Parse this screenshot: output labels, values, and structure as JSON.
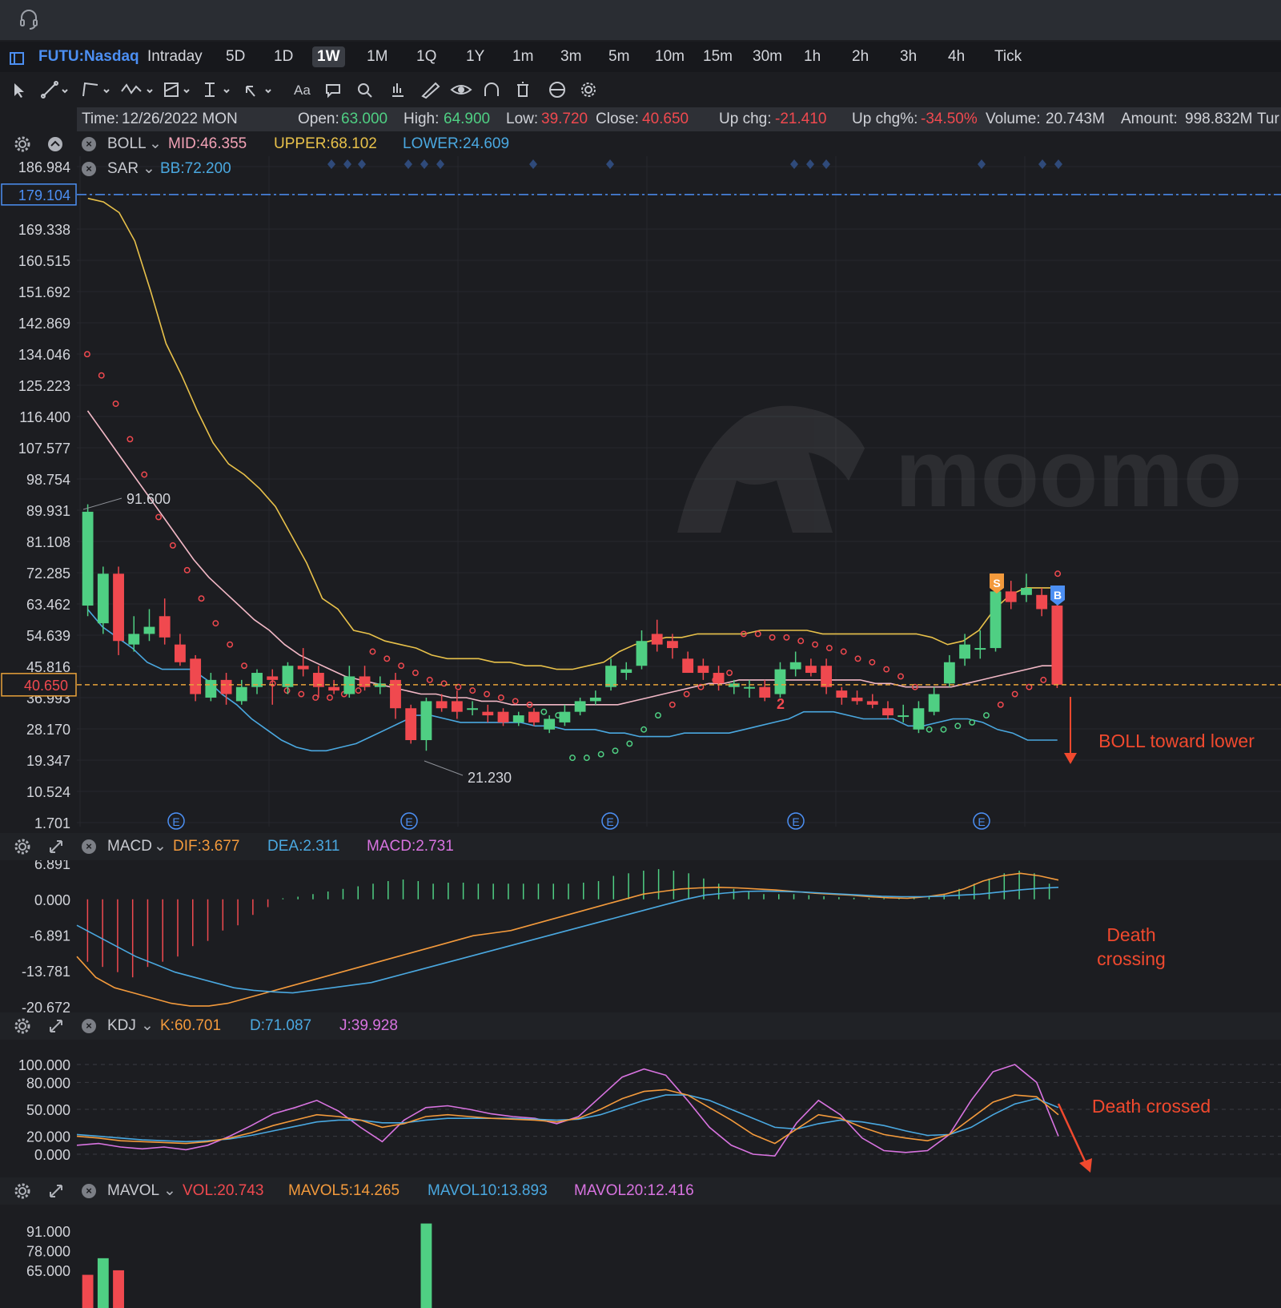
{
  "toolbar_top": {
    "headset_icon": "headset-icon"
  },
  "timeframe_bar": {
    "symbol": "FUTU:Nasdaq",
    "tabs": [
      "Intraday",
      "5D",
      "1D",
      "1W",
      "1M",
      "1Q",
      "1Y",
      "1m",
      "3m",
      "5m",
      "10m",
      "15m",
      "30m",
      "1h",
      "2h",
      "3h",
      "4h",
      "Tick"
    ],
    "active": "1W"
  },
  "drawing_tools": [
    "cursor-icon",
    "line-tool-icon",
    "channel-tool-icon",
    "wave-tool-icon",
    "fib-tool-icon",
    "measure-tool-icon",
    "arrow-tool-icon",
    "text-tool-icon",
    "comment-tool-icon",
    "search-icon",
    "indicator-icon",
    "pen-icon",
    "eye-icon",
    "magnet-icon",
    "trash-icon",
    "sync-icon",
    "gear-icon"
  ],
  "text_tool_label": "Aa",
  "info": {
    "time_label": "Time:",
    "time": "12/26/2022 MON",
    "open_label": "Open:",
    "open": "63.000",
    "high_label": "High:",
    "high": "64.900",
    "low_label": "Low:",
    "low": "39.720",
    "close_label": "Close:",
    "close": "40.650",
    "upchg_label": "Up chg:",
    "upchg": "-21.410",
    "upchgp_label": "Up chg%:",
    "upchgp": "-34.50%",
    "volume_label": "Volume:",
    "volume": "20.743M",
    "amount_label": "Amount:",
    "amount": "998.832M",
    "turnover_label": "Tur"
  },
  "boll_legend": {
    "name": "BOLL",
    "mid": "MID:46.355",
    "upper": "UPPER:68.102",
    "lower": "LOWER:24.609"
  },
  "sar_legend": {
    "name": "SAR",
    "bb": "BB:72.200"
  },
  "macd_legend": {
    "name": "MACD",
    "dif": "DIF:3.677",
    "dea": "DEA:2.311",
    "macd": "MACD:2.731"
  },
  "kdj_legend": {
    "name": "KDJ",
    "k": "K:60.701",
    "d": "D:71.087",
    "j": "J:39.928"
  },
  "mavol_legend": {
    "name": "MAVOL",
    "vol": "VOL:20.743",
    "m5": "MAVOL5:14.265",
    "m10": "MAVOL10:13.893",
    "m20": "MAVOL20:12.416"
  },
  "price_axis": [
    "186.984",
    "179.104",
    "169.338",
    "160.515",
    "151.692",
    "142.869",
    "134.046",
    "125.223",
    "116.400",
    "107.577",
    "98.754",
    "89.931",
    "81.108",
    "72.285",
    "63.462",
    "54.639",
    "45.816",
    "36.993",
    "28.170",
    "19.347",
    "10.524",
    "1.701"
  ],
  "crosshair_price": "179.104",
  "last_price": "40.650",
  "high_marker": "91.600",
  "low_marker": "21.230",
  "earnings_marker": "E",
  "sell_marker": "S",
  "buy_marker": "B",
  "trade_count_marker": "2",
  "macd_axis": [
    "6.891",
    "0.000",
    "-6.891",
    "-13.781",
    "-20.672"
  ],
  "kdj_axis": [
    "100.000",
    "80.000",
    "50.000",
    "20.000",
    "0.000"
  ],
  "vol_axis": [
    "91.000",
    "78.000",
    "65.000"
  ],
  "watermark": "moomo",
  "annotations": {
    "boll": "BOLL toward lower",
    "macd_line1": "Death",
    "macd_line2": "crossing",
    "kdj": "Death crossed"
  },
  "colors": {
    "up": "#4fcf83",
    "down": "#f0494f",
    "boll_mid": "#f2b8c6",
    "boll_upper": "#e8c14a",
    "boll_lower": "#4aa8e0",
    "dif": "#f39a3c",
    "dea": "#4aa8e0",
    "j": "#d873e0",
    "annotation": "#f0492e",
    "accent": "#4c8ff3"
  },
  "chart_data": {
    "type": "candlestick",
    "title": "FUTU:Nasdaq 1W",
    "ylim": [
      1.701,
      186.984
    ],
    "candles": [
      {
        "o": 63,
        "h": 91.6,
        "l": 60,
        "c": 89.5
      },
      {
        "o": 58,
        "h": 74,
        "l": 55,
        "c": 72
      },
      {
        "o": 72,
        "h": 74,
        "l": 49,
        "c": 53
      },
      {
        "o": 52,
        "h": 60,
        "l": 50,
        "c": 55
      },
      {
        "o": 55,
        "h": 62,
        "l": 53,
        "c": 57
      },
      {
        "o": 60,
        "h": 65,
        "l": 52,
        "c": 54
      },
      {
        "o": 52,
        "h": 55,
        "l": 46,
        "c": 47
      },
      {
        "o": 48,
        "h": 49,
        "l": 36,
        "c": 38
      },
      {
        "o": 37,
        "h": 44,
        "l": 36,
        "c": 42
      },
      {
        "o": 42,
        "h": 44,
        "l": 35,
        "c": 38
      },
      {
        "o": 36,
        "h": 42,
        "l": 35,
        "c": 40
      },
      {
        "o": 40,
        "h": 45,
        "l": 38,
        "c": 44
      },
      {
        "o": 43,
        "h": 45,
        "l": 35,
        "c": 42
      },
      {
        "o": 40,
        "h": 47,
        "l": 38,
        "c": 46
      },
      {
        "o": 46,
        "h": 51,
        "l": 43,
        "c": 45
      },
      {
        "o": 44,
        "h": 46,
        "l": 37,
        "c": 40
      },
      {
        "o": 40,
        "h": 42,
        "l": 38,
        "c": 39
      },
      {
        "o": 38,
        "h": 46,
        "l": 37,
        "c": 43
      },
      {
        "o": 43,
        "h": 46,
        "l": 39,
        "c": 40
      },
      {
        "o": 40,
        "h": 43,
        "l": 38,
        "c": 41
      },
      {
        "o": 42,
        "h": 44,
        "l": 31,
        "c": 34
      },
      {
        "o": 34,
        "h": 35,
        "l": 24,
        "c": 25
      },
      {
        "o": 25,
        "h": 37,
        "l": 22,
        "c": 36
      },
      {
        "o": 36,
        "h": 38,
        "l": 33,
        "c": 34
      },
      {
        "o": 36,
        "h": 39,
        "l": 31,
        "c": 33
      },
      {
        "o": 34,
        "h": 36,
        "l": 32,
        "c": 34
      },
      {
        "o": 33,
        "h": 35,
        "l": 30,
        "c": 32
      },
      {
        "o": 33,
        "h": 34,
        "l": 29,
        "c": 30
      },
      {
        "o": 30,
        "h": 33,
        "l": 29,
        "c": 32
      },
      {
        "o": 33,
        "h": 34,
        "l": 29,
        "c": 30
      },
      {
        "o": 28,
        "h": 32,
        "l": 27,
        "c": 31
      },
      {
        "o": 30,
        "h": 35,
        "l": 29,
        "c": 33
      },
      {
        "o": 33,
        "h": 37,
        "l": 32,
        "c": 36
      },
      {
        "o": 36,
        "h": 39,
        "l": 35,
        "c": 37
      },
      {
        "o": 40,
        "h": 48,
        "l": 39,
        "c": 46
      },
      {
        "o": 44,
        "h": 47,
        "l": 42,
        "c": 45
      },
      {
        "o": 46,
        "h": 56,
        "l": 45,
        "c": 53
      },
      {
        "o": 55,
        "h": 59,
        "l": 50,
        "c": 52
      },
      {
        "o": 53,
        "h": 55,
        "l": 48,
        "c": 51
      },
      {
        "o": 48,
        "h": 50,
        "l": 44,
        "c": 44
      },
      {
        "o": 46,
        "h": 48,
        "l": 42,
        "c": 44
      },
      {
        "o": 44,
        "h": 46,
        "l": 39,
        "c": 41
      },
      {
        "o": 40,
        "h": 42,
        "l": 38,
        "c": 41
      },
      {
        "o": 40,
        "h": 42,
        "l": 37,
        "c": 40
      },
      {
        "o": 40,
        "h": 42,
        "l": 36,
        "c": 37
      },
      {
        "o": 38,
        "h": 47,
        "l": 37,
        "c": 45
      },
      {
        "o": 45,
        "h": 50,
        "l": 43,
        "c": 47
      },
      {
        "o": 46,
        "h": 48,
        "l": 43,
        "c": 44
      },
      {
        "o": 46,
        "h": 48,
        "l": 38,
        "c": 40
      },
      {
        "o": 39,
        "h": 40,
        "l": 35,
        "c": 37
      },
      {
        "o": 37,
        "h": 39,
        "l": 35,
        "c": 36
      },
      {
        "o": 36,
        "h": 38,
        "l": 34,
        "c": 35
      },
      {
        "o": 34,
        "h": 36,
        "l": 31,
        "c": 32
      },
      {
        "o": 32,
        "h": 35,
        "l": 30,
        "c": 32
      },
      {
        "o": 28,
        "h": 36,
        "l": 27,
        "c": 34
      },
      {
        "o": 33,
        "h": 40,
        "l": 32,
        "c": 38
      },
      {
        "o": 41,
        "h": 49,
        "l": 40,
        "c": 47
      },
      {
        "o": 48,
        "h": 55,
        "l": 46,
        "c": 52
      },
      {
        "o": 51,
        "h": 56,
        "l": 48,
        "c": 51
      },
      {
        "o": 51,
        "h": 70,
        "l": 50,
        "c": 67
      },
      {
        "o": 67,
        "h": 70,
        "l": 62,
        "c": 64
      },
      {
        "o": 66,
        "h": 72,
        "l": 64,
        "c": 68
      },
      {
        "o": 66,
        "h": 68,
        "l": 60,
        "c": 62
      },
      {
        "o": 63,
        "h": 64.9,
        "l": 39.72,
        "c": 40.65
      }
    ],
    "boll_mid": [
      118,
      112,
      106,
      100,
      94,
      88,
      82,
      76,
      71,
      67,
      63,
      59,
      56,
      52,
      49,
      47,
      45,
      43,
      42,
      41,
      40,
      39,
      38,
      38,
      37,
      37,
      36,
      36,
      35,
      35,
      35,
      35,
      35,
      35,
      35,
      35,
      36,
      37,
      38,
      39,
      40,
      41,
      41,
      42,
      42,
      42,
      42,
      42,
      42,
      42,
      42,
      42,
      41,
      41,
      40,
      40,
      40,
      40,
      41,
      42,
      43,
      44,
      45,
      46,
      46
    ],
    "boll_upper": [
      178,
      177,
      174,
      166,
      152,
      137,
      128,
      118,
      109,
      103,
      100,
      96,
      91,
      83,
      75,
      65,
      62,
      56,
      55,
      53,
      52,
      51,
      49,
      48,
      48,
      48,
      47,
      47,
      46,
      46,
      45,
      45,
      46,
      47,
      50,
      52,
      53,
      54,
      54,
      55,
      55,
      55,
      55,
      56,
      56,
      56,
      56,
      55,
      55,
      55,
      55,
      55,
      55,
      55,
      54,
      52,
      53,
      56,
      62,
      66,
      68,
      68,
      68
    ],
    "boll_lower": [
      62,
      57,
      54,
      51,
      47,
      45,
      45,
      45,
      42,
      38,
      35,
      31,
      28,
      25,
      23,
      22,
      22,
      23,
      24,
      26,
      28,
      30,
      32,
      32,
      31,
      30,
      30,
      30,
      30,
      30,
      29,
      29,
      28,
      28,
      28,
      27,
      27,
      26,
      26,
      26,
      27,
      27,
      27,
      27,
      28,
      29,
      30,
      31,
      33,
      33,
      33,
      32,
      31,
      31,
      31,
      29,
      29,
      30,
      31,
      31,
      30,
      28,
      27,
      25,
      25,
      25
    ],
    "sar_points": [
      134,
      128,
      120,
      110,
      100,
      88,
      80,
      73,
      65,
      58,
      52,
      46,
      43,
      41,
      39,
      38,
      37,
      37,
      38,
      39,
      50,
      48,
      46,
      44,
      42,
      41,
      40,
      39,
      38,
      37,
      36,
      35,
      33,
      32,
      20,
      20,
      21,
      22,
      24,
      28,
      32,
      35,
      38,
      40,
      42,
      44,
      55,
      55,
      54,
      54,
      53,
      52,
      51,
      50,
      48,
      47,
      45,
      43,
      40,
      28,
      28,
      29,
      30,
      32,
      35,
      38,
      40,
      42,
      72
    ]
  },
  "macd_chart": {
    "type": "bar",
    "ylim": [
      -20.672,
      6.891
    ],
    "hist": [
      -12,
      -13,
      -14,
      -15,
      -13,
      -12,
      -11,
      -9,
      -8,
      -6,
      -5,
      -3,
      -1.5,
      0.2,
      0.5,
      1,
      1.5,
      2,
      2.5,
      3,
      3.5,
      3.8,
      3.5,
      3,
      3.2,
      3.2,
      3,
      3,
      3,
      3,
      3,
      3,
      3,
      3.2,
      3.5,
      4.5,
      5,
      5.5,
      5.8,
      5.5,
      5,
      4,
      3,
      2,
      1.5,
      1,
      1,
      1,
      0.8,
      0.6,
      0.4,
      0.3,
      0.2,
      0.2,
      0.2,
      0.3,
      0.5,
      1,
      2,
      3,
      4,
      5,
      5.5,
      5,
      3
    ],
    "dif": [
      -11,
      -15,
      -17,
      -18,
      -19,
      -20,
      -20.5,
      -20.5,
      -20,
      -19,
      -18,
      -17,
      -16,
      -15,
      -14,
      -13,
      -12,
      -11,
      -10,
      -9,
      -8,
      -7,
      -6.5,
      -6,
      -5,
      -4,
      -3,
      -2,
      -1,
      0,
      1,
      1.5,
      2,
      2.2,
      2.3,
      2.2,
      2,
      1.8,
      1.5,
      1.2,
      1,
      0.8,
      0.5,
      0.3,
      0.2,
      0.5,
      1,
      2,
      3.5,
      4.5,
      5,
      4.5,
      3.7
    ],
    "dea": [
      -5,
      -7,
      -9,
      -11,
      -12.5,
      -14,
      -15,
      -16,
      -17,
      -17.5,
      -17.8,
      -18,
      -17.5,
      -17,
      -16.5,
      -16,
      -15,
      -14,
      -13,
      -12,
      -11,
      -10,
      -9,
      -8,
      -7,
      -6,
      -5,
      -4,
      -3,
      -2,
      -1,
      0,
      0.8,
      1.2,
      1.5,
      1.6,
      1.5,
      1.4,
      1.2,
      1,
      0.8,
      0.6,
      0.5,
      0.5,
      0.6,
      0.8,
      1,
      1.4,
      1.8,
      2.1,
      2.3
    ]
  },
  "kdj_chart": {
    "type": "line",
    "ylim": [
      0,
      100
    ],
    "k": [
      20,
      18,
      15,
      14,
      13,
      12,
      14,
      18,
      24,
      32,
      38,
      44,
      42,
      38,
      30,
      34,
      42,
      44,
      42,
      40,
      39,
      38,
      36,
      40,
      50,
      62,
      70,
      72,
      66,
      52,
      38,
      22,
      12,
      28,
      44,
      40,
      30,
      22,
      18,
      15,
      22,
      40,
      58,
      66,
      64,
      44
    ],
    "d": [
      22,
      20,
      18,
      16,
      15,
      14,
      15,
      17,
      21,
      26,
      31,
      36,
      38,
      38,
      35,
      35,
      38,
      40,
      40,
      40,
      40,
      39,
      38,
      39,
      44,
      52,
      60,
      66,
      66,
      60,
      50,
      40,
      30,
      28,
      34,
      38,
      36,
      32,
      26,
      21,
      22,
      30,
      44,
      56,
      62,
      52
    ],
    "j": [
      10,
      12,
      8,
      6,
      8,
      5,
      10,
      20,
      32,
      45,
      52,
      60,
      48,
      30,
      14,
      38,
      52,
      54,
      50,
      45,
      42,
      40,
      34,
      42,
      64,
      86,
      95,
      88,
      60,
      30,
      10,
      0,
      -2,
      35,
      60,
      44,
      18,
      4,
      2,
      4,
      22,
      60,
      92,
      100,
      80,
      20
    ]
  },
  "vol_chart": {
    "type": "bar",
    "ylim": [
      0,
      100
    ],
    "values": [
      62,
      73,
      65
    ],
    "spike": 96
  }
}
